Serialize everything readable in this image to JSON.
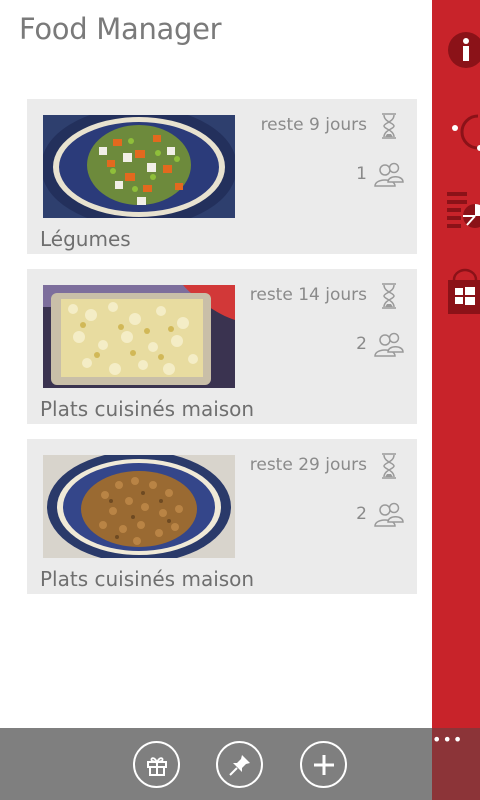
{
  "app": {
    "title": "Food Manager"
  },
  "items": [
    {
      "days_left": "reste 9 jours",
      "people": "1",
      "category": "Légumes",
      "photo": "vegetables-bowl"
    },
    {
      "days_left": "reste 14 jours",
      "people": "2",
      "category": "Plats cuisinés maison",
      "photo": "pasta-container"
    },
    {
      "days_left": "reste 29 jours",
      "people": "2",
      "category": "Plats cuisinés maison",
      "photo": "chickpeas-bowl"
    }
  ],
  "side_panel": {
    "color": "#c8232a",
    "icons": [
      "info-icon",
      "loading-ring-icon",
      "list-pie-icon",
      "store-icon"
    ]
  },
  "app_bar": {
    "more": "•••",
    "buttons": [
      "gift-icon",
      "pin-icon",
      "add-icon"
    ]
  }
}
